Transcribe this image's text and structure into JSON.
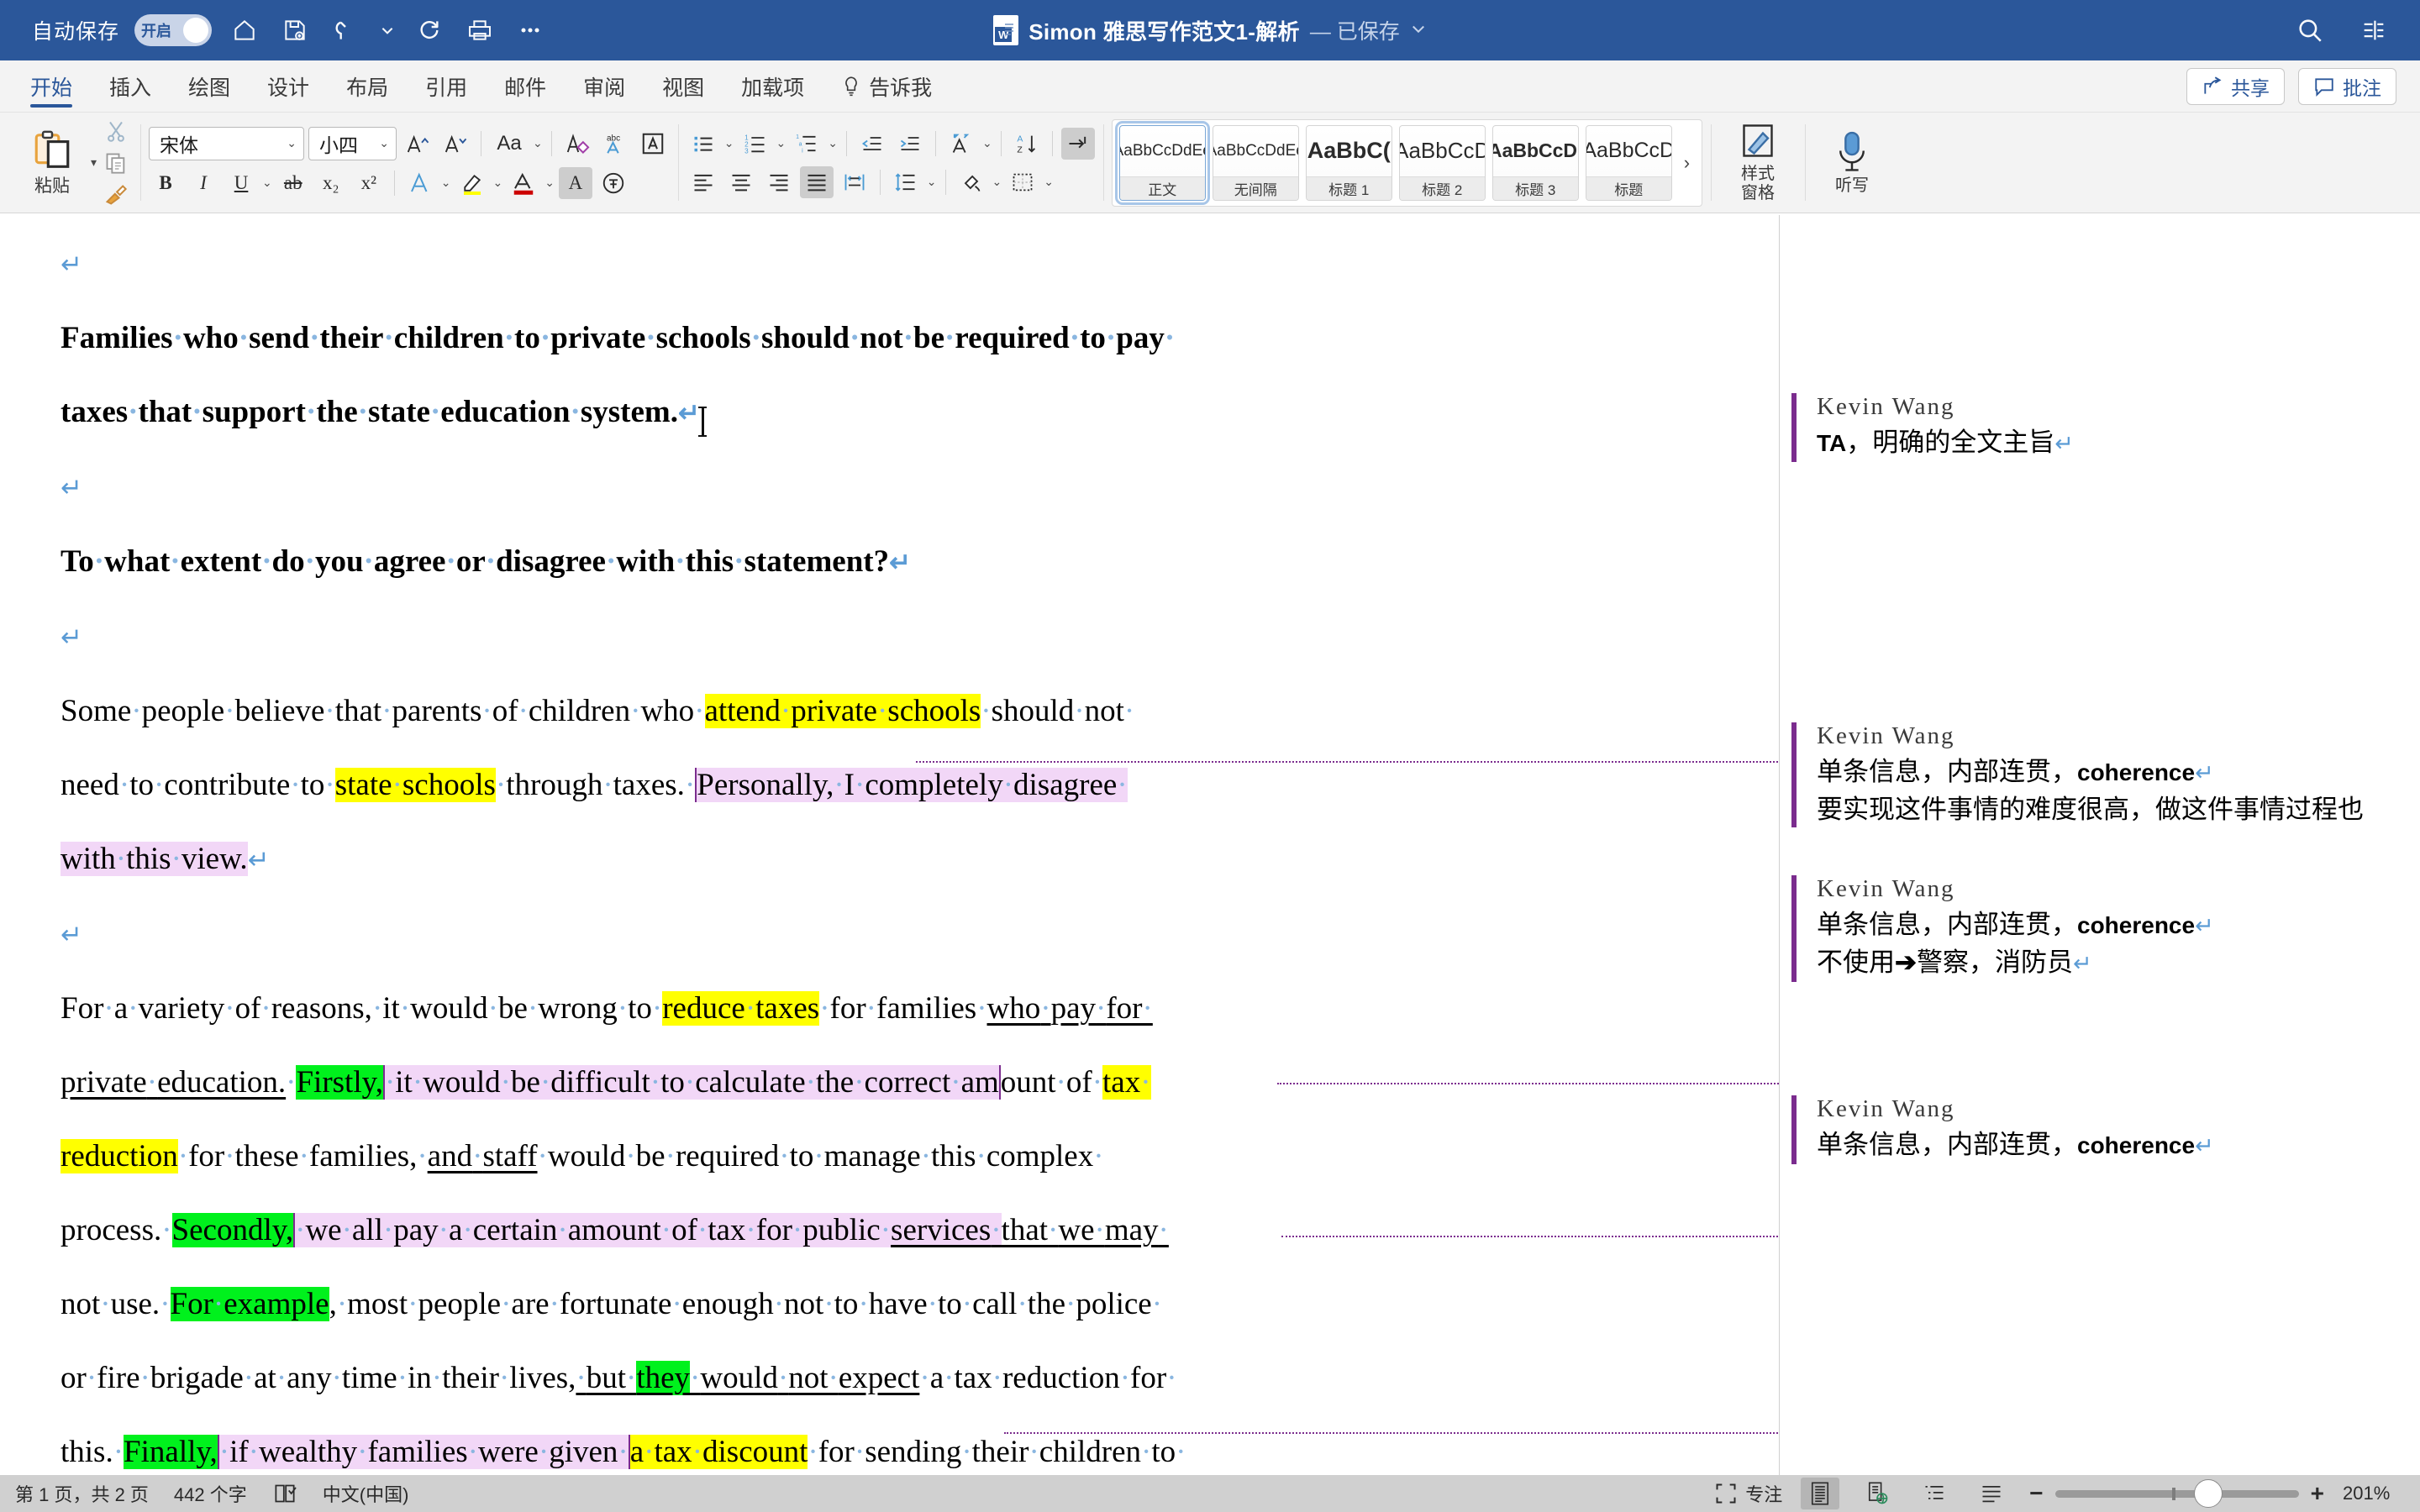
{
  "titlebar": {
    "autosave_label": "自动保存",
    "autosave_state": "开启",
    "doc_title": "Simon 雅思写作范文1-解析",
    "saved_status": "— 已保存",
    "icons": [
      "home-icon",
      "save-icon",
      "undo-icon",
      "redo-icon",
      "print-icon",
      "more-commands-icon"
    ],
    "right_icons": [
      "search-icon",
      "ribbon-display-icon"
    ],
    "accent_color": "#2b579a"
  },
  "ribbon": {
    "tabs": [
      {
        "label": "开始",
        "active": true
      },
      {
        "label": "插入",
        "active": false
      },
      {
        "label": "绘图",
        "active": false
      },
      {
        "label": "设计",
        "active": false
      },
      {
        "label": "布局",
        "active": false
      },
      {
        "label": "引用",
        "active": false
      },
      {
        "label": "邮件",
        "active": false
      },
      {
        "label": "审阅",
        "active": false
      },
      {
        "label": "视图",
        "active": false
      },
      {
        "label": "加载项",
        "active": false
      },
      {
        "label": "告诉我",
        "active": false
      }
    ],
    "share_label": "共享",
    "comment_label": "批注",
    "clipboard": {
      "paste_label": "粘贴",
      "cut_icon": "scissors-icon",
      "copy_icon": "copy-icon",
      "format_painter_icon": "format-painter-icon"
    },
    "font": {
      "family": "宋体",
      "size": "小四",
      "grow_icon": "grow-font-icon",
      "shrink_icon": "shrink-font-icon",
      "change_case_label": "Aa",
      "clear_format_icon": "clear-formatting-icon",
      "phonetic_icon": "phonetic-guide-icon",
      "char_border_icon": "character-border-icon",
      "bold_label": "B",
      "italic_label": "I",
      "underline_label": "U",
      "strike_label": "ab",
      "subscript_label": "x₂",
      "superscript_label": "x²",
      "text_effects_icon": "text-effects-icon",
      "highlight_icon": "highlight-color-icon",
      "font_color_icon": "font-color-icon",
      "shading_icon": "character-shading-icon",
      "enclose_icon": "enclose-character-icon"
    },
    "paragraph": {
      "bullets_icon": "bullet-list-icon",
      "numbering_icon": "numbered-list-icon",
      "multilevel_icon": "multilevel-list-icon",
      "decrease_indent_icon": "decrease-indent-icon",
      "increase_indent_icon": "increase-indent-icon",
      "asian_layout_icon": "asian-layout-icon",
      "sort_icon": "sort-icon",
      "show_marks_icon": "show-formatting-marks-icon",
      "align_left_icon": "align-left-icon",
      "align_center_icon": "align-center-icon",
      "align_right_icon": "align-right-icon",
      "justify_icon": "justify-icon",
      "distribute_icon": "distribute-icon",
      "line_spacing_icon": "line-spacing-icon",
      "shading_icon": "paragraph-shading-icon",
      "borders_icon": "borders-icon"
    },
    "styles": [
      {
        "preview": "AaBbCcDdEe",
        "name": "正文",
        "selected": true,
        "cls": ""
      },
      {
        "preview": "AaBbCcDdEe",
        "name": "无间隔",
        "selected": false,
        "cls": ""
      },
      {
        "preview": "AaBbC(",
        "name": "标题 1",
        "selected": false,
        "cls": "h1"
      },
      {
        "preview": "AaBbCcD",
        "name": "标题 2",
        "selected": false,
        "cls": "h2"
      },
      {
        "preview": "AaBbCcDı",
        "name": "标题 3",
        "selected": false,
        "cls": "h3"
      },
      {
        "preview": "AaBbCcD",
        "name": "标题",
        "selected": false,
        "cls": "ti"
      }
    ],
    "styles_more_icon": "chevron-right-icon",
    "style_pane_label": "样式\n窗格",
    "dictate_label": "听写"
  },
  "document": {
    "paragraphs": [
      {
        "type": "empty"
      },
      {
        "type": "bold",
        "runs": [
          {
            "t": "Families·who·send·their·children·to·private·schools·should·not·be·required·to·pay·"
          },
          {
            "t": "taxes·that·support·the·state·education·system.",
            "nl": true
          },
          {
            "t": "¶",
            "mark": true
          }
        ]
      },
      {
        "type": "empty"
      },
      {
        "type": "bold",
        "runs": [
          {
            "t": "To·what·extent·do·you·agree·or·disagree·with·this·statement?"
          },
          {
            "t": "¶",
            "mark": true
          }
        ]
      },
      {
        "type": "empty"
      },
      {
        "type": "body",
        "runs": [
          {
            "t": "Some·people·believe·that·parents·of·children·who·"
          },
          {
            "t": "attend·private·schools",
            "hl": "yellow"
          },
          {
            "t": "·should·not·"
          },
          {
            "t": "need·to·contribute·to·",
            "nl": true
          },
          {
            "t": "state·schools",
            "hl": "yellow"
          },
          {
            "t": "·through·taxes.·"
          },
          {
            "t": "Personally,·I·completely·disagree·",
            "cmt": true
          },
          {
            "t": "with·this·view.",
            "cmt": true,
            "nl": true
          },
          {
            "t": "¶",
            "mark": true
          }
        ]
      },
      {
        "type": "empty"
      },
      {
        "type": "body",
        "runs": [
          {
            "t": "For·a·variety·of·reasons,·it·would·be·wrong·to·"
          },
          {
            "t": "reduce·taxes",
            "hl": "yellow"
          },
          {
            "t": "·for·families·"
          },
          {
            "t": "who·pay·for·",
            "u": true
          },
          {
            "t": "private·education.",
            "u": true,
            "nl": true
          },
          {
            "t": "·"
          },
          {
            "t": "Firstly,",
            "hl": "green"
          },
          {
            "t": "·it·would·be·difficult·to·calculate·the·correct·amount·of·",
            "cmt": true
          },
          {
            "t": "tax·",
            "hl": "yellow"
          },
          {
            "t": "reduction",
            "hl": "yellow",
            "nl": true
          },
          {
            "t": "·for·these·families,·"
          },
          {
            "t": "and·staff",
            "u": true
          },
          {
            "t": "·would·be·required·to·manage·this·complex·"
          },
          {
            "t": "process.·",
            "nl": true
          },
          {
            "t": "Secondly,",
            "hl": "green"
          },
          {
            "t": "·we·all·pay·a·certain·amount·of·tax·for·public·",
            "cmt": true
          },
          {
            "t": "services·",
            "cmt": true,
            "u": true
          },
          {
            "t": "that·we·may·",
            "u": true
          },
          {
            "t": "not·use.·",
            "nl": true
          },
          {
            "t": "For·example",
            "hl": "green"
          },
          {
            "t": ",·most·people·are·fortunate·enough·not·to·have·to·call·the·police·"
          },
          {
            "t": "or·fire·brigade·at·any·time·in·their·lives,",
            "nl": true
          },
          {
            "t": "·but·",
            "u": true
          },
          {
            "t": "they",
            "hl": "green",
            "u": true
          },
          {
            "t": "·would·not·expect",
            "u": true
          },
          {
            "t": "·a·tax·reduction·for·"
          },
          {
            "t": "this.·",
            "nl": true
          },
          {
            "t": "Finally,",
            "hl": "green"
          },
          {
            "t": "·if·wealthy·families·were·given·",
            "cmt": true
          },
          {
            "t": "a·tax·discount",
            "hl": "yellow"
          },
          {
            "t": "·for·sending·their·children·to·"
          }
        ]
      }
    ]
  },
  "comments": [
    {
      "author": "Kevin Wang",
      "lines": [
        "TA，明确的全文主旨"
      ],
      "bold_first": true
    },
    {
      "author": "Kevin Wang",
      "lines": [
        "单条信息，内部连贯，coherence",
        "要实现这件事情的难度很高，做这件事情过程也"
      ]
    },
    {
      "author": "Kevin Wang",
      "lines": [
        "单条信息，内部连贯，coherence",
        "不使用➔警察，消防员"
      ]
    },
    {
      "author": "Kevin Wang",
      "lines": [
        "单条信息，内部连贯，coherence"
      ]
    }
  ],
  "statusbar": {
    "page_info": "第 1 页，共 2 页",
    "word_count": "442 个字",
    "proofing_icon": "proofing-icon",
    "language": "中文(中国)",
    "focus_label": "专注",
    "focus_icon": "focus-icon",
    "view_print_icon": "print-layout-icon",
    "view_web_icon": "web-layout-icon",
    "view_outline_icon": "outline-view-icon",
    "view_draft_icon": "draft-view-icon",
    "zoom_out_label": "−",
    "zoom_in_label": "+",
    "zoom_value": "201%"
  }
}
